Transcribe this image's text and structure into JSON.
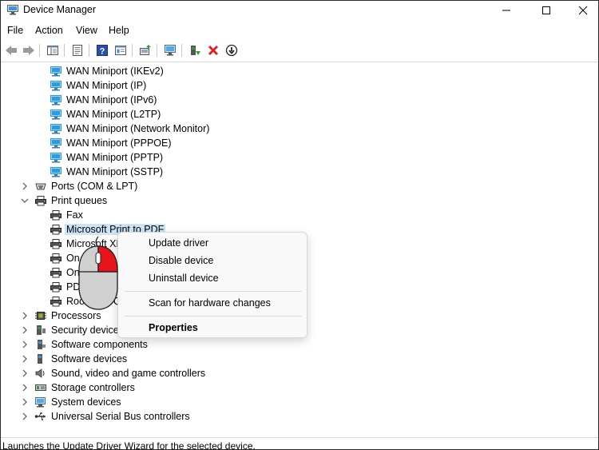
{
  "window": {
    "title": "Device Manager"
  },
  "menu": [
    "File",
    "Action",
    "View",
    "Help"
  ],
  "toolbar_icons": [
    "back-arrow-icon",
    "forward-arrow-icon",
    "show-hide-console-tree-icon",
    "properties-sheet-icon",
    "help-icon",
    "device-properties-icon",
    "update-driver-icon",
    "scan-hardware-icon",
    "enable-device-icon",
    "uninstall-device-icon",
    "rollback-driver-icon"
  ],
  "tree": {
    "wan_items": [
      "WAN Miniport (IKEv2)",
      "WAN Miniport (IP)",
      "WAN Miniport (IPv6)",
      "WAN Miniport (L2TP)",
      "WAN Miniport (Network Monitor)",
      "WAN Miniport (PPPOE)",
      "WAN Miniport (PPTP)",
      "WAN Miniport (SSTP)"
    ],
    "ports": "Ports (COM & LPT)",
    "print_queues": "Print queues",
    "print_items": [
      "Fax",
      "Microsoft Print to PDF",
      "Microsoft XPS",
      "On",
      "On",
      "PD",
      "Root Print Q"
    ],
    "categories": [
      "Processors",
      "Security devices",
      "Software components",
      "Software devices",
      "Sound, video and game controllers",
      "Storage controllers",
      "System devices",
      "Universal Serial Bus controllers"
    ]
  },
  "context_menu": {
    "update_driver": "Update driver",
    "disable_device": "Disable device",
    "uninstall_device": "Uninstall device",
    "scan_hardware": "Scan for hardware changes",
    "properties": "Properties"
  },
  "status": "Launches the Update Driver Wizard for the selected device.",
  "colors": {
    "selection": "#cce4f7",
    "network_icon": "#2b9ae0",
    "mouse_highlight": "#e8141c"
  }
}
